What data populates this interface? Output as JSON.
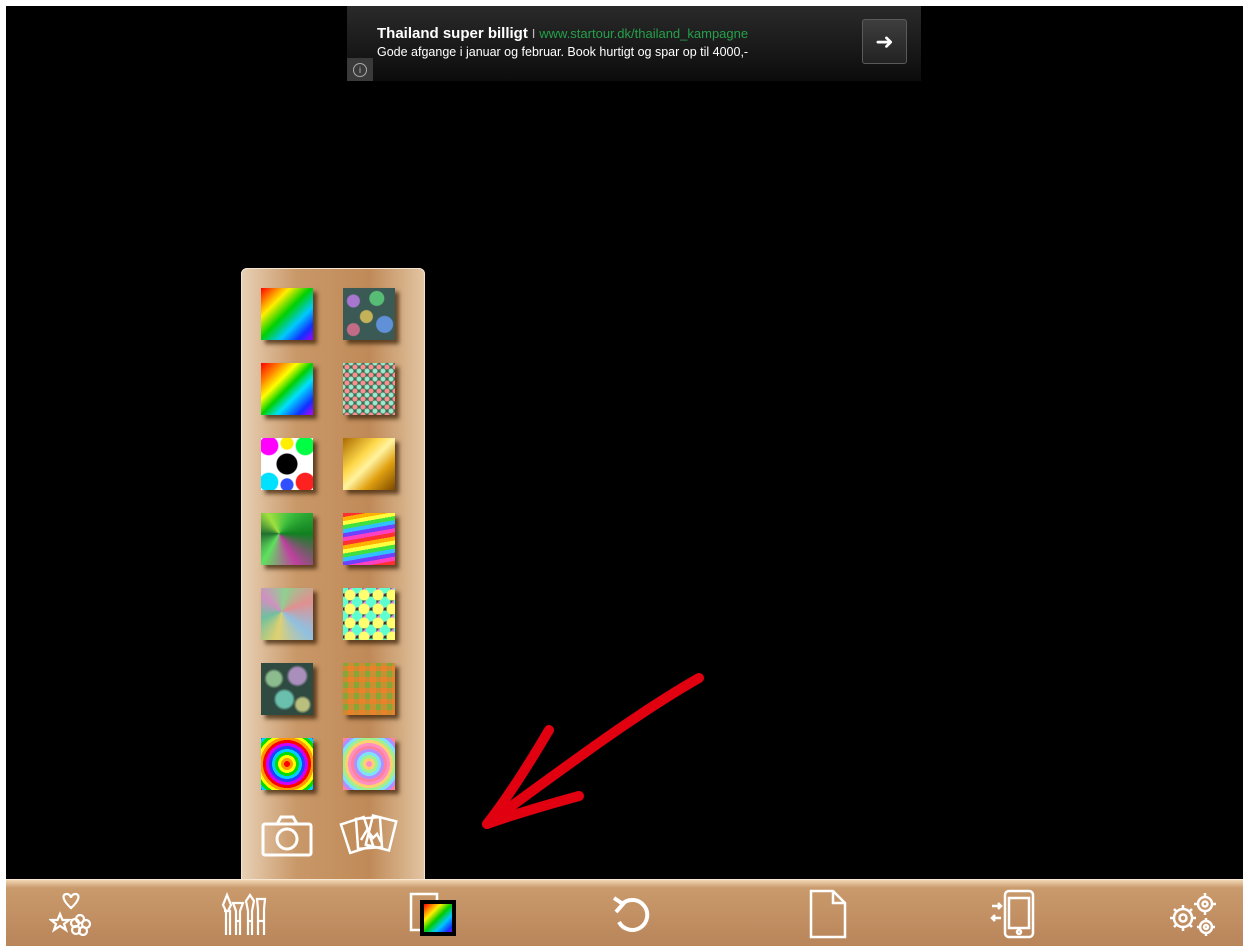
{
  "ad": {
    "title": "Thailand super billigt",
    "separator": "I",
    "url": "www.startour.dk/thailand_kampagne",
    "description": "Gode afgange i januar og februar. Book hurtigt og spar op til 4000,-",
    "info_icon": "info-icon",
    "cta_icon": "arrow-right-icon"
  },
  "pattern_panel": {
    "patterns": [
      "rainbow-gradient",
      "bokeh-dots",
      "rainbow-diagonal",
      "mosaic-dots",
      "neon-circles",
      "gold-gradient",
      "green-polygons",
      "rainbow-waves",
      "pastel-polygons",
      "stained-glass",
      "blur-bokeh",
      "warm-squares",
      "rainbow-rings",
      "pastel-rings"
    ],
    "buttons": [
      "camera-icon",
      "photo-gallery-icon"
    ]
  },
  "toolbar": {
    "items": [
      "shapes-icon",
      "brushes-icon",
      "backgrounds-icon",
      "undo-icon",
      "new-page-icon",
      "device-transfer-icon",
      "settings-icon"
    ]
  },
  "colors": {
    "panel": "#c99868",
    "toolbar": "#b9855a",
    "canvas": "#000000",
    "ad_url": "#24a04a",
    "annotation_arrow": "#e00010"
  }
}
